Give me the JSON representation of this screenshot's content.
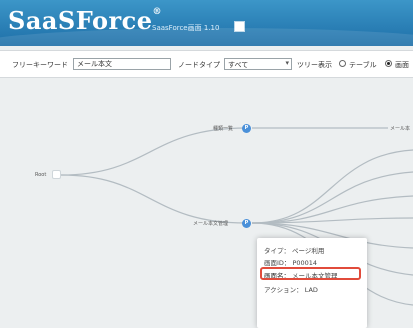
{
  "header": {
    "logo": "SaaSForce",
    "logo_mark": "®",
    "version": "SaasForce画面 1.10"
  },
  "filter": {
    "keyword_label": "フリーキーワード",
    "keyword_value": "メール本文",
    "node_type_label": "ノードタイプ",
    "node_type_value": "すべて",
    "tree_display_label": "ツリー表示",
    "option_table": "テーブル",
    "option_graph": "画面",
    "selected_option": "画面"
  },
  "tree": {
    "root_label": "Root",
    "node1_label": "種類一覧",
    "node1_badge": "P",
    "node2_label": "メール本文管理",
    "node2_badge": "P",
    "node3_label": "メール本"
  },
  "tooltip": {
    "type_label": "タイプ：",
    "type_value": "ページ利用",
    "id_label": "画面ID：",
    "id_value": "P00014",
    "name_label": "画面名：",
    "name_value": "メール本文管理",
    "action_label": "アクション：",
    "action_value": "LAD"
  }
}
